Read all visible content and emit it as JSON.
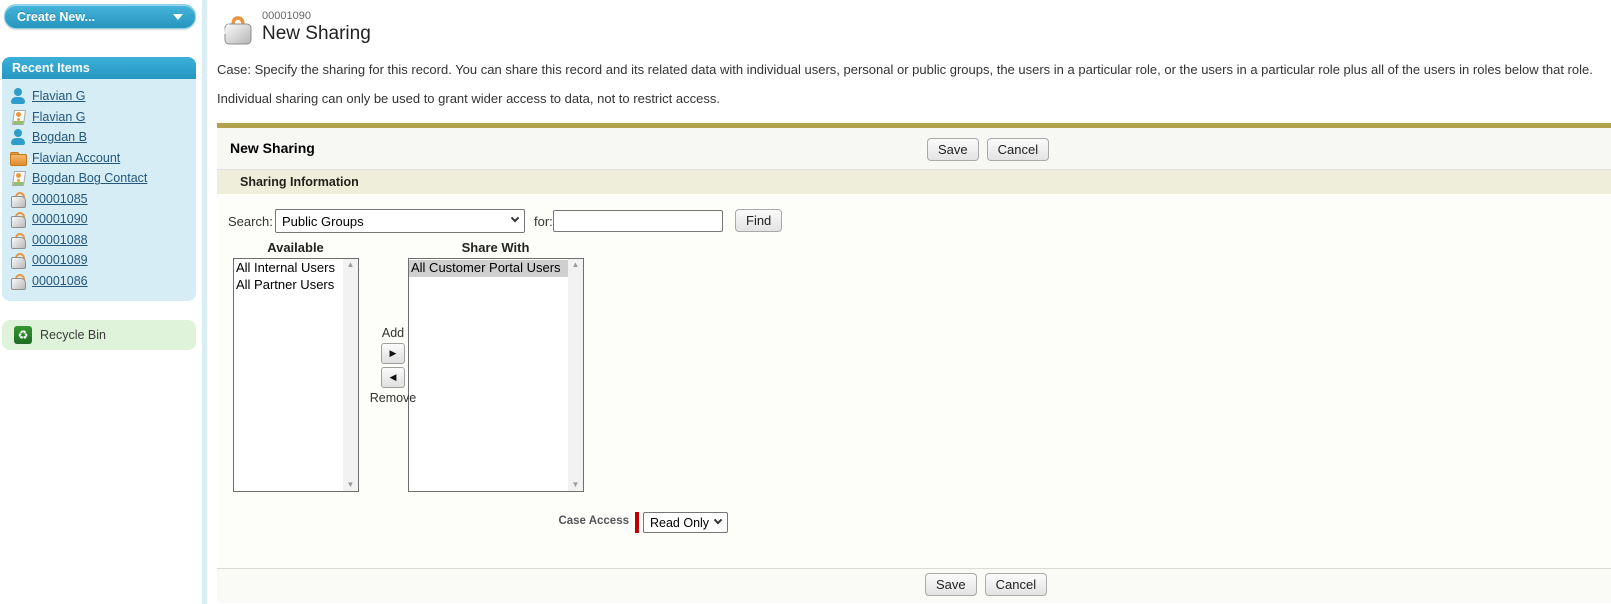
{
  "sidebar": {
    "create_new_label": "Create New...",
    "recent_items": {
      "title": "Recent Items",
      "items": [
        {
          "label": "Flavian G",
          "icon": "user-icon"
        },
        {
          "label": "Flavian G",
          "icon": "contact-icon"
        },
        {
          "label": "Bogdan B",
          "icon": "user-icon"
        },
        {
          "label": "Flavian Account",
          "icon": "folder-icon"
        },
        {
          "label": "Bogdan Bog Contact",
          "icon": "contact-icon"
        },
        {
          "label": "00001085",
          "icon": "case-icon"
        },
        {
          "label": "00001090",
          "icon": "case-icon"
        },
        {
          "label": "00001088",
          "icon": "case-icon"
        },
        {
          "label": "00001089",
          "icon": "case-icon"
        },
        {
          "label": "00001086",
          "icon": "case-icon"
        }
      ]
    },
    "recycle_bin_label": "Recycle Bin"
  },
  "header": {
    "record_number": "00001090",
    "title": "New Sharing"
  },
  "description": {
    "line1": "Case: Specify the sharing for this record. You can share this record and its related data with individual users, personal or public groups, the users in a particular role, or the users in a particular role plus all of the users in roles below that role.",
    "line2": "Individual sharing can only be used to grant wider access to data, not to restrict access."
  },
  "form": {
    "title": "New Sharing",
    "save_label": "Save",
    "cancel_label": "Cancel",
    "section_title": "Sharing Information",
    "search": {
      "label": "Search:",
      "selected_option": "Public Groups",
      "for_label": "for:",
      "input_value": "",
      "find_label": "Find"
    },
    "available": {
      "label": "Available",
      "options": [
        {
          "label": "All Internal Users",
          "selected": false
        },
        {
          "label": "All Partner Users",
          "selected": false
        }
      ]
    },
    "share_with": {
      "label": "Share With",
      "options": [
        {
          "label": "All Customer Portal Users",
          "selected": true
        }
      ]
    },
    "add_label": "Add",
    "remove_label": "Remove",
    "case_access": {
      "label": "Case Access",
      "selected_option": "Read Only"
    }
  },
  "colors": {
    "accent_gold": "#b3a14b",
    "sidebar_teal": "#2f9ec7",
    "sidebar_body_blue": "#d7edf5",
    "recycle_green": "#def3d9",
    "link_blue": "#24577c",
    "section_beige": "#efeedb",
    "required_red": "#c00000",
    "selected_option_gray": "#cfcfcf"
  }
}
